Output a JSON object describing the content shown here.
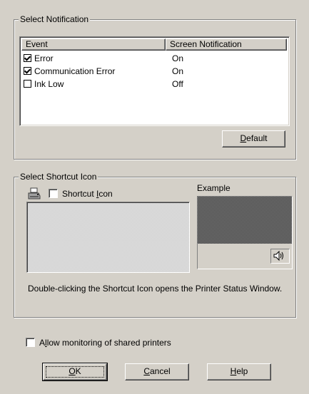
{
  "notification_group": {
    "title": "Select Notification",
    "columns": [
      "Event",
      "Screen Notification"
    ],
    "rows": [
      {
        "event": "Error",
        "checked": true,
        "value": "On"
      },
      {
        "event": "Communication Error",
        "checked": true,
        "value": "On"
      },
      {
        "event": "Ink Low",
        "checked": false,
        "value": "Off"
      }
    ],
    "default_button": {
      "pre": "",
      "hotkey": "D",
      "post": "efault"
    }
  },
  "shortcut_group": {
    "title": "Select Shortcut Icon",
    "checkbox": {
      "pre": "Shortcut ",
      "hotkey": "I",
      "post": "con"
    },
    "example_label": "Example",
    "description": "Double-clicking the Shortcut Icon opens the Printer Status Window."
  },
  "monitor_shared": {
    "pre": "A",
    "hotkey": "l",
    "post": "low monitoring of shared printers"
  },
  "buttons": {
    "ok": {
      "hotkey": "O",
      "post": "K"
    },
    "cancel": {
      "hotkey": "C",
      "post": "ancel"
    },
    "help": {
      "hotkey": "H",
      "post": "elp"
    }
  },
  "icons": {
    "printer": "printer-icon",
    "speaker": "speaker-icon"
  }
}
